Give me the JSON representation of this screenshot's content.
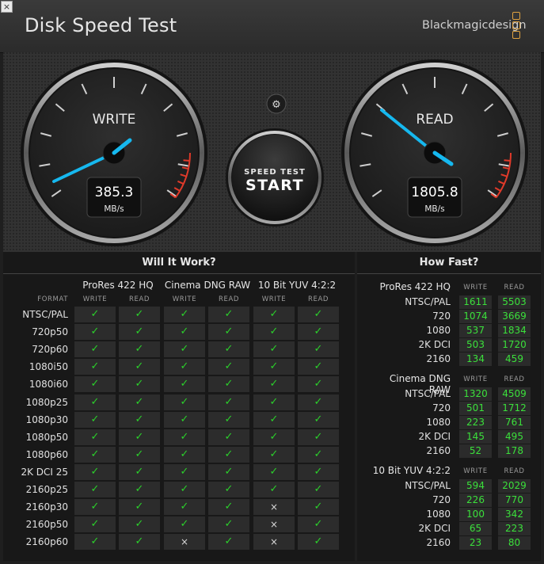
{
  "window": {
    "close_glyph": "×",
    "title": "Disk Speed Test",
    "brand": "Blackmagicdesign"
  },
  "gauges": {
    "write": {
      "label": "WRITE",
      "value": "385.3",
      "unit": "MB/s"
    },
    "read": {
      "label": "READ",
      "value": "1805.8",
      "unit": "MB/s"
    }
  },
  "start_button": {
    "line1": "SPEED TEST",
    "line2": "START"
  },
  "settings_icon": "⚙",
  "will_it_work": {
    "title": "Will It Work?",
    "format_label": "FORMAT",
    "groups": [
      "ProRes 422 HQ",
      "Cinema DNG RAW",
      "10 Bit YUV 4:2:2"
    ],
    "subheads": [
      "WRITE",
      "READ"
    ],
    "rows": [
      {
        "label": "NTSC/PAL",
        "cells": [
          "✓",
          "✓",
          "✓",
          "✓",
          "✓",
          "✓"
        ]
      },
      {
        "label": "720p50",
        "cells": [
          "✓",
          "✓",
          "✓",
          "✓",
          "✓",
          "✓"
        ]
      },
      {
        "label": "720p60",
        "cells": [
          "✓",
          "✓",
          "✓",
          "✓",
          "✓",
          "✓"
        ]
      },
      {
        "label": "1080i50",
        "cells": [
          "✓",
          "✓",
          "✓",
          "✓",
          "✓",
          "✓"
        ]
      },
      {
        "label": "1080i60",
        "cells": [
          "✓",
          "✓",
          "✓",
          "✓",
          "✓",
          "✓"
        ]
      },
      {
        "label": "1080p25",
        "cells": [
          "✓",
          "✓",
          "✓",
          "✓",
          "✓",
          "✓"
        ]
      },
      {
        "label": "1080p30",
        "cells": [
          "✓",
          "✓",
          "✓",
          "✓",
          "✓",
          "✓"
        ]
      },
      {
        "label": "1080p50",
        "cells": [
          "✓",
          "✓",
          "✓",
          "✓",
          "✓",
          "✓"
        ]
      },
      {
        "label": "1080p60",
        "cells": [
          "✓",
          "✓",
          "✓",
          "✓",
          "✓",
          "✓"
        ]
      },
      {
        "label": "2K DCI 25",
        "cells": [
          "✓",
          "✓",
          "✓",
          "✓",
          "✓",
          "✓"
        ]
      },
      {
        "label": "2160p25",
        "cells": [
          "✓",
          "✓",
          "✓",
          "✓",
          "✓",
          "✓"
        ]
      },
      {
        "label": "2160p30",
        "cells": [
          "✓",
          "✓",
          "✓",
          "✓",
          "×",
          "✓"
        ]
      },
      {
        "label": "2160p50",
        "cells": [
          "✓",
          "✓",
          "✓",
          "✓",
          "×",
          "✓"
        ]
      },
      {
        "label": "2160p60",
        "cells": [
          "✓",
          "✓",
          "×",
          "✓",
          "×",
          "✓"
        ]
      }
    ]
  },
  "how_fast": {
    "title": "How Fast?",
    "subheads": [
      "WRITE",
      "READ"
    ],
    "groups": [
      {
        "name": "ProRes 422 HQ",
        "rows": [
          {
            "label": "NTSC/PAL",
            "write": "1611",
            "read": "5503"
          },
          {
            "label": "720",
            "write": "1074",
            "read": "3669"
          },
          {
            "label": "1080",
            "write": "537",
            "read": "1834"
          },
          {
            "label": "2K DCI",
            "write": "503",
            "read": "1720"
          },
          {
            "label": "2160",
            "write": "134",
            "read": "459"
          }
        ]
      },
      {
        "name": "Cinema DNG RAW",
        "rows": [
          {
            "label": "NTSC/PAL",
            "write": "1320",
            "read": "4509"
          },
          {
            "label": "720",
            "write": "501",
            "read": "1712"
          },
          {
            "label": "1080",
            "write": "223",
            "read": "761"
          },
          {
            "label": "2K DCI",
            "write": "145",
            "read": "495"
          },
          {
            "label": "2160",
            "write": "52",
            "read": "178"
          }
        ]
      },
      {
        "name": "10 Bit YUV 4:2:2",
        "rows": [
          {
            "label": "NTSC/PAL",
            "write": "594",
            "read": "2029"
          },
          {
            "label": "720",
            "write": "226",
            "read": "770"
          },
          {
            "label": "1080",
            "write": "100",
            "read": "342"
          },
          {
            "label": "2K DCI",
            "write": "65",
            "read": "223"
          },
          {
            "label": "2160",
            "write": "23",
            "read": "80"
          }
        ]
      }
    ]
  },
  "colors": {
    "accent_needle": "#16b8ef",
    "ok": "#2bd12b",
    "redline": "#e03a2a",
    "brand_logo": "#e0a240"
  }
}
